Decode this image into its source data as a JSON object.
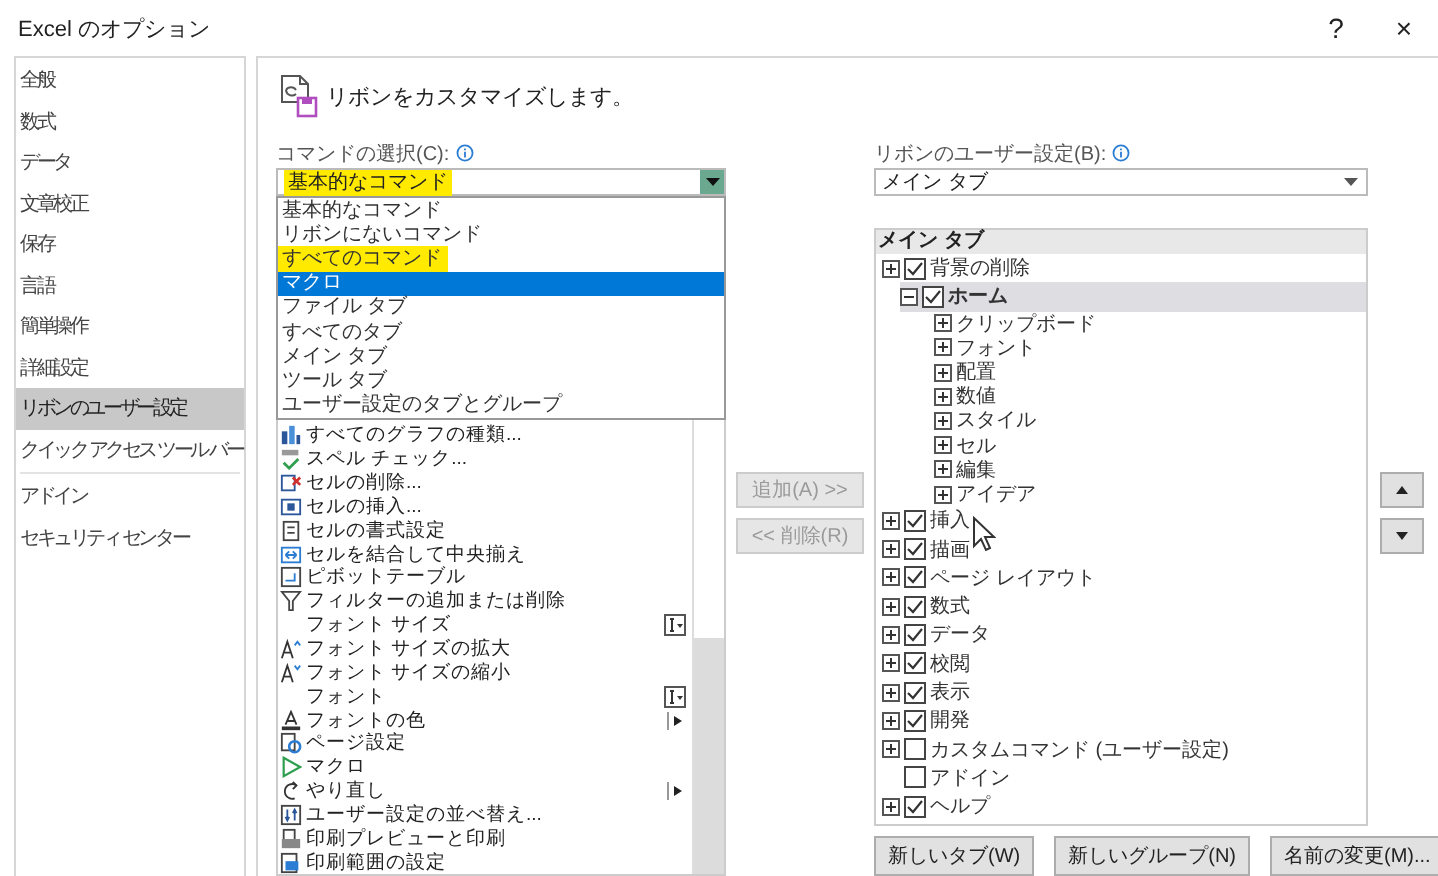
{
  "window": {
    "title": "Excel のオプション",
    "help": "?",
    "close": "×"
  },
  "sidebar": {
    "items": [
      {
        "label": "全般",
        "selected": false
      },
      {
        "label": "数式",
        "selected": false
      },
      {
        "label": "データ",
        "selected": false
      },
      {
        "label": "文章校正",
        "selected": false
      },
      {
        "label": "保存",
        "selected": false
      },
      {
        "label": "言語",
        "selected": false
      },
      {
        "label": "簡単操作",
        "selected": false
      },
      {
        "label": "詳細設定",
        "selected": false
      },
      {
        "label": "リボンのユーザー設定",
        "selected": true
      },
      {
        "label": "クイック アクセス ツール バー",
        "selected": false
      },
      {
        "label": "アドイン",
        "selected": false
      },
      {
        "label": "セキュリティ センター",
        "selected": false
      }
    ]
  },
  "header": {
    "title": "リボンをカスタマイズします。"
  },
  "commands": {
    "label": "コマンドの選択(C):",
    "dropdown": {
      "value": "基本的なコマンド",
      "highlighted": true
    },
    "options": [
      {
        "label": "基本的なコマンド",
        "selected": false,
        "highlighted": false
      },
      {
        "label": "リボンにないコマンド",
        "selected": false,
        "highlighted": false
      },
      {
        "label": "すべてのコマンド",
        "selected": false,
        "highlighted": true
      },
      {
        "label": "マクロ",
        "selected": true,
        "highlighted": false
      },
      {
        "label": "ファイル タブ",
        "selected": false,
        "highlighted": false
      },
      {
        "label": "すべてのタブ",
        "selected": false,
        "highlighted": false
      },
      {
        "label": "メイン タブ",
        "selected": false,
        "highlighted": false
      },
      {
        "label": "ツール タブ",
        "selected": false,
        "highlighted": false
      },
      {
        "label": "ユーザー設定のタブとグループ",
        "selected": false,
        "highlighted": false
      }
    ],
    "items": [
      {
        "label": "すべてのグラフの種類...",
        "kind": "plain"
      },
      {
        "label": "スペル チェック...",
        "kind": "plain"
      },
      {
        "label": "セルの削除...",
        "kind": "plain"
      },
      {
        "label": "セルの挿入...",
        "kind": "plain"
      },
      {
        "label": "セルの書式設定",
        "kind": "plain"
      },
      {
        "label": "セルを結合して中央揃え",
        "kind": "plain"
      },
      {
        "label": "ピボットテーブル",
        "kind": "plain"
      },
      {
        "label": "フィルターの追加または削除",
        "kind": "plain"
      },
      {
        "label": "フォント サイズ",
        "kind": "field"
      },
      {
        "label": "フォント サイズの拡大",
        "kind": "plain"
      },
      {
        "label": "フォント サイズの縮小",
        "kind": "plain"
      },
      {
        "label": "フォント",
        "kind": "field"
      },
      {
        "label": "フォントの色",
        "kind": "submenu"
      },
      {
        "label": "ページ設定",
        "kind": "plain"
      },
      {
        "label": "マクロ",
        "kind": "plain"
      },
      {
        "label": "やり直し",
        "kind": "submenu"
      },
      {
        "label": "ユーザー設定の並べ替え...",
        "kind": "plain"
      },
      {
        "label": "印刷プレビューと印刷",
        "kind": "plain"
      },
      {
        "label": "印刷範囲の設定",
        "kind": "plain"
      }
    ]
  },
  "transfer": {
    "add": {
      "label": "追加(A) >>",
      "disabled": true
    },
    "remove": {
      "label": "<< 削除(R)",
      "disabled": true
    }
  },
  "ribbon": {
    "label": "リボンのユーザー設定(B):",
    "dropdown": {
      "value": "メイン タブ"
    },
    "tree": {
      "header": "メイン タブ",
      "tabs": [
        {
          "label": "背景の削除",
          "checked": true,
          "expandable": true,
          "expanded": false,
          "selected": false
        },
        {
          "label": "ホーム",
          "checked": true,
          "expandable": true,
          "expanded": true,
          "selected": true,
          "children": [
            {
              "label": "クリップボード"
            },
            {
              "label": "フォント"
            },
            {
              "label": "配置"
            },
            {
              "label": "数値"
            },
            {
              "label": "スタイル"
            },
            {
              "label": "セル"
            },
            {
              "label": "編集"
            },
            {
              "label": "アイデア"
            }
          ]
        },
        {
          "label": "挿入",
          "checked": true,
          "expandable": true,
          "expanded": false,
          "selected": false
        },
        {
          "label": "描画",
          "checked": true,
          "expandable": true,
          "expanded": false,
          "selected": false
        },
        {
          "label": "ページ レイアウト",
          "checked": true,
          "expandable": true,
          "expanded": false,
          "selected": false
        },
        {
          "label": "数式",
          "checked": true,
          "expandable": true,
          "expanded": false,
          "selected": false
        },
        {
          "label": "データ",
          "checked": true,
          "expandable": true,
          "expanded": false,
          "selected": false
        },
        {
          "label": "校閲",
          "checked": true,
          "expandable": true,
          "expanded": false,
          "selected": false
        },
        {
          "label": "表示",
          "checked": true,
          "expandable": true,
          "expanded": false,
          "selected": false
        },
        {
          "label": "開発",
          "checked": true,
          "expandable": true,
          "expanded": false,
          "selected": false
        },
        {
          "label": "カスタムコマンド (ユーザー設定)",
          "checked": false,
          "expandable": true,
          "expanded": false,
          "selected": false
        },
        {
          "label": "アドイン",
          "checked": false,
          "expandable": false,
          "expanded": false,
          "selected": false
        },
        {
          "label": "ヘルプ",
          "checked": true,
          "expandable": true,
          "expanded": false,
          "selected": false
        }
      ]
    },
    "buttons": [
      "新しいタブ(W)",
      "新しいグループ(N)",
      "名前の変更(M)..."
    ]
  }
}
